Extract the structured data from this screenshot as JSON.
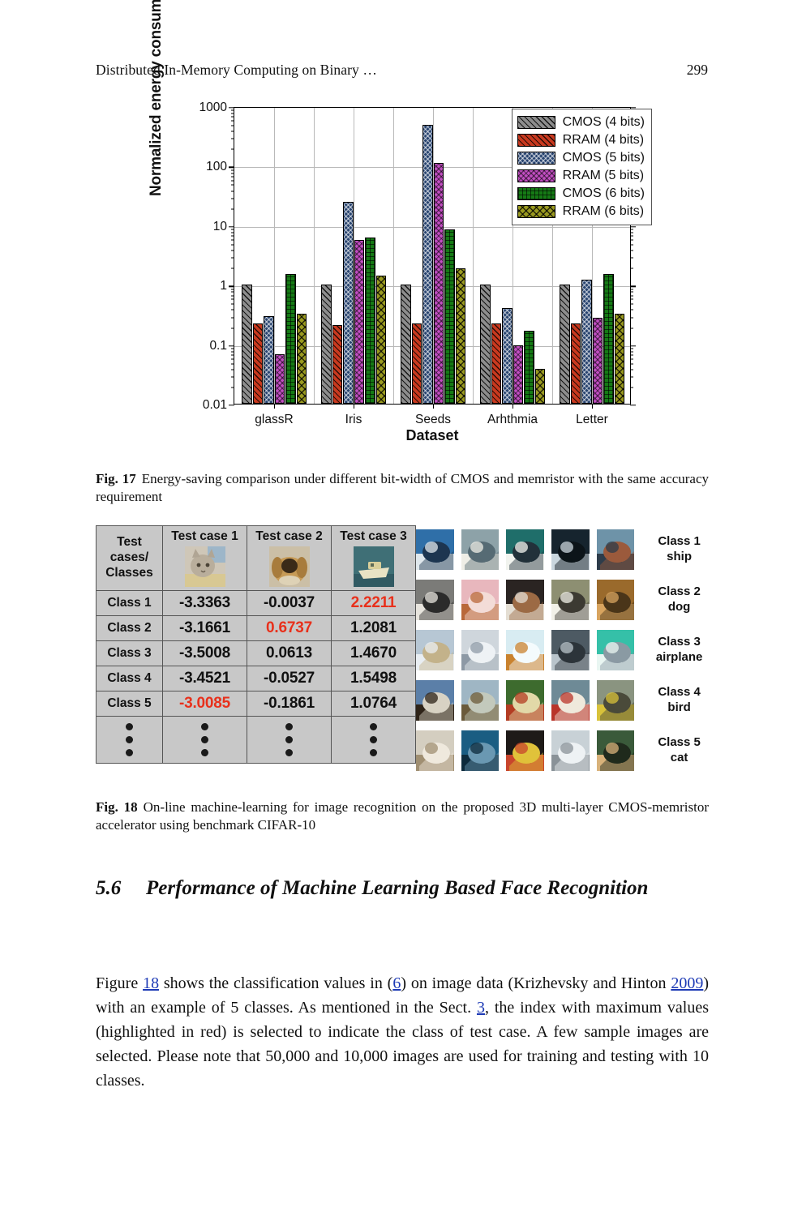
{
  "running_head": {
    "title": "Distributed In-Memory Computing on Binary …",
    "page_number": "299"
  },
  "figure17": {
    "caption_lead": "Fig. 17",
    "caption_text": "Energy-saving comparison under different bit-width of CMOS and memristor with the same accuracy requirement"
  },
  "chart_data": {
    "type": "bar",
    "title": "",
    "xlabel": "Dataset",
    "ylabel": "Normalized energy consumption",
    "yscale": "log",
    "ylim": [
      0.01,
      1000
    ],
    "yticks": [
      "0.01",
      "0.1",
      "1",
      "10",
      "100",
      "1000"
    ],
    "categories": [
      "glassR",
      "Iris",
      "Seeds",
      "Arhthmia",
      "Letter"
    ],
    "legend_position": "top-right",
    "grid": true,
    "series": [
      {
        "name": "CMOS (4 bits)",
        "color": "#8d8d8d",
        "pattern": "diagonal-hatch",
        "values": [
          1.0,
          1.0,
          1.0,
          1.0,
          1.0
        ]
      },
      {
        "name": "RRAM (4 bits)",
        "color": "#c8391f",
        "pattern": "diagonal-hatch",
        "values": [
          0.225,
          0.21,
          0.22,
          0.22,
          0.22
        ]
      },
      {
        "name": "CMOS (5 bits)",
        "color": "#27436f",
        "pattern": "cross-dot",
        "values": [
          0.3,
          25.0,
          480.0,
          0.4,
          1.2
        ]
      },
      {
        "name": "RRAM (5 bits)",
        "color": "#c14ec1",
        "pattern": "cross-hatch",
        "values": [
          0.068,
          5.7,
          110.0,
          0.095,
          0.28
        ]
      },
      {
        "name": "CMOS (6 bits)",
        "color": "#157a15",
        "pattern": "grid",
        "values": [
          1.5,
          6.3,
          8.5,
          0.17,
          1.5
        ]
      },
      {
        "name": "RRAM (6 bits)",
        "color": "#9a9a20",
        "pattern": "cross-hatch",
        "values": [
          0.33,
          1.4,
          1.9,
          0.038,
          0.33
        ]
      }
    ]
  },
  "figure18": {
    "caption_lead": "Fig. 18",
    "caption_text": "On-line machine-learning for image recognition on the proposed 3D multi-layer CMOS-memristor accelerator using benchmark CIFAR-10",
    "table": {
      "corner_label": "Test cases/ Classes",
      "columns": [
        "Test case 1",
        "Test case 2",
        "Test case 3"
      ],
      "rows": [
        {
          "label": "Class 1",
          "values": [
            "-3.3363",
            "-0.0037",
            "2.2211"
          ],
          "highlight": [
            false,
            false,
            true
          ]
        },
        {
          "label": "Class 2",
          "values": [
            "-3.1661",
            "0.6737",
            "1.2081"
          ],
          "highlight": [
            false,
            true,
            false
          ]
        },
        {
          "label": "Class 3",
          "values": [
            "-3.5008",
            "0.0613",
            "1.4670"
          ],
          "highlight": [
            false,
            false,
            false
          ]
        },
        {
          "label": "Class 4",
          "values": [
            "-3.4521",
            "-0.0527",
            "1.5498"
          ],
          "highlight": [
            false,
            false,
            false
          ]
        },
        {
          "label": "Class 5",
          "values": [
            "-3.0085",
            "-0.1861",
            "1.0764"
          ],
          "highlight": [
            true,
            false,
            false
          ]
        }
      ],
      "continuation": "vertical-dots"
    },
    "class_legend": [
      {
        "number": "Class 1",
        "name": "ship"
      },
      {
        "number": "Class 2",
        "name": "dog"
      },
      {
        "number": "Class 3",
        "name": "airplane"
      },
      {
        "number": "Class 4",
        "name": "bird"
      },
      {
        "number": "Class 5",
        "name": "cat"
      }
    ]
  },
  "section": {
    "number": "5.6",
    "title": "Performance of Machine Learning Based Face Recognition"
  },
  "body_paragraph": {
    "p1": "Figure ",
    "link1": "18",
    "p2": " shows the classification values in (",
    "link2": "6",
    "p3": ") on image data (Krizhevsky and Hinton ",
    "link3": "2009",
    "p4": ") with an example of 5 classes. As mentioned in the Sect. ",
    "link4": "3",
    "p5": ", the index with maximum values (highlighted in red) is selected to indicate the class of test case. A few sample images are selected. Please note that 50,000 and 10,000 images are used for training and testing with 10 classes."
  }
}
